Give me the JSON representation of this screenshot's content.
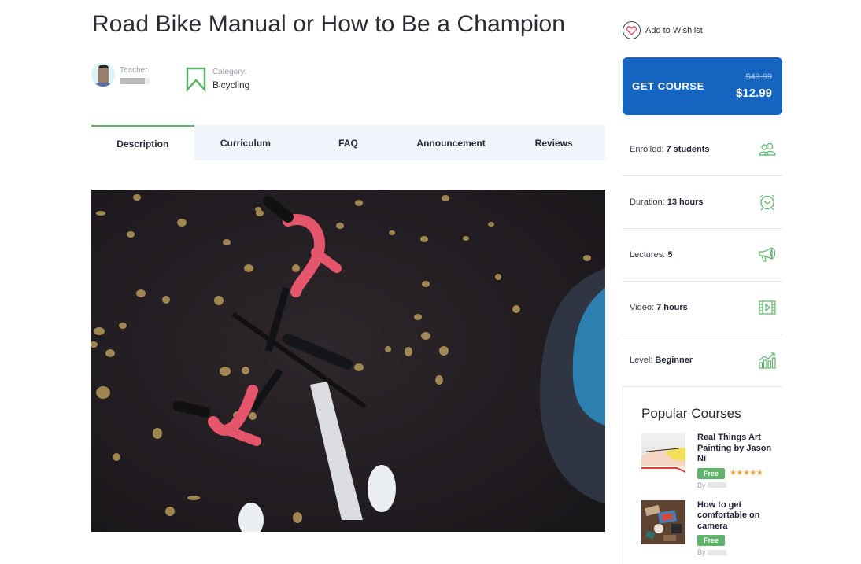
{
  "course": {
    "title": "Road Bike Manual or How to Be a Champion",
    "teacher_label": "Teacher",
    "category_label": "Category:",
    "category_value": "Bicycling"
  },
  "tabs": [
    {
      "label": "Description",
      "active": true
    },
    {
      "label": "Curriculum",
      "active": false
    },
    {
      "label": "FAQ",
      "active": false
    },
    {
      "label": "Announcement",
      "active": false
    },
    {
      "label": "Reviews",
      "active": false
    }
  ],
  "sidebar": {
    "wishlist_label": "Add to Wishlist",
    "get_course_label": "GET COURSE",
    "old_price": "$49.99",
    "new_price": "$12.99",
    "stats": [
      {
        "label": "Enrolled:",
        "value": "7 students",
        "icon": "users-icon"
      },
      {
        "label": "Duration:",
        "value": "13 hours",
        "icon": "alarm-clock-icon"
      },
      {
        "label": "Lectures:",
        "value": "5",
        "icon": "megaphone-icon"
      },
      {
        "label": "Video:",
        "value": "7 hours",
        "icon": "video-film-icon"
      },
      {
        "label": "Level:",
        "value": "Beginner",
        "icon": "growth-chart-icon"
      }
    ],
    "accent_color": "#5fb36b",
    "button_color": "#1565c0"
  },
  "popular": {
    "heading": "Popular Courses",
    "courses": [
      {
        "title": "Real Things Art Painting by Jason Ni",
        "badge": "Free",
        "rating": "5 stars",
        "by": "By"
      },
      {
        "title": "How to get comfortable on camera",
        "badge": "Free",
        "by": "By"
      }
    ]
  }
}
